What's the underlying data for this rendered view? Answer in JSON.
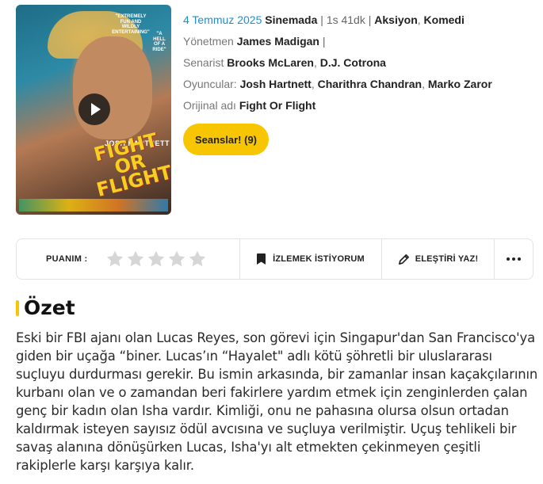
{
  "poster": {
    "quote_1": "\"EXTREMELY FUN AND WILDLY ENTERTAINING\"",
    "quote_2": "\"A HELL OF A RIDE\"",
    "actor_text": "JOSH HARTNETT",
    "title_art": "FIGHT OR FLIGHT",
    "play_icon": "play-icon"
  },
  "movie": {
    "release_date": "4 Temmuz 2025",
    "status": "Sinemada",
    "separator": "|",
    "duration": "1s 41dk",
    "genres": [
      "Aksiyon",
      "Komedi"
    ],
    "director_label": "Yönetmen",
    "directors": [
      "James Madigan"
    ],
    "writer_label": "Senarist",
    "writers": [
      "Brooks McLaren",
      "D.J. Cotrona"
    ],
    "cast_label": "Oyuncular:",
    "cast": [
      "Josh Hartnett",
      "Charithra Chandran",
      "Marko Zaror"
    ],
    "original_title_label": "Orijinal adı",
    "original_title": "Fight Or Flight"
  },
  "actions": {
    "sessions_button": "Seanslar! (9)",
    "rating_label": "PUANIM :",
    "stars_count": 5,
    "rating_value": 0,
    "watch_label": "İZLEMEK İSTİYORUM",
    "critique_label": "ELEŞTİRİ YAZ!",
    "more_icon": "more-dots-icon"
  },
  "summary": {
    "heading": "Özet",
    "text": "Eski bir FBI ajanı olan Lucas Reyes, son görevi için Singapur'dan San Francisco'ya giden bir uçağa “biner. Lucas’ın “Hayalet\" adlı kötü şöhretli bir uluslararası suçluyu durdurması gerekir. Bu ismin arkasında, bir zamanlar insan kaçakçılarının kurbanı olan ve o zamandan beri fakirlere yardım etmek için zenginlerden çalan genç bir kadın olan Isha vardır. Kimliği, onu ne pahasına olursa olsun ortadan kaldırmak isteyen sayısız ödül avcısına ve suçluya verilmiştir. Uçuş tehlikeli bir savaş alanına dönüşürken Lucas, Isha'yı alt etmekten çekinmeyen çeşitli rakiplerle karşı karşıya kalır."
  },
  "colors": {
    "accent_yellow": "#f7c600",
    "date_blue": "#1f8ec9",
    "star_gray": "#d6d6d6"
  }
}
